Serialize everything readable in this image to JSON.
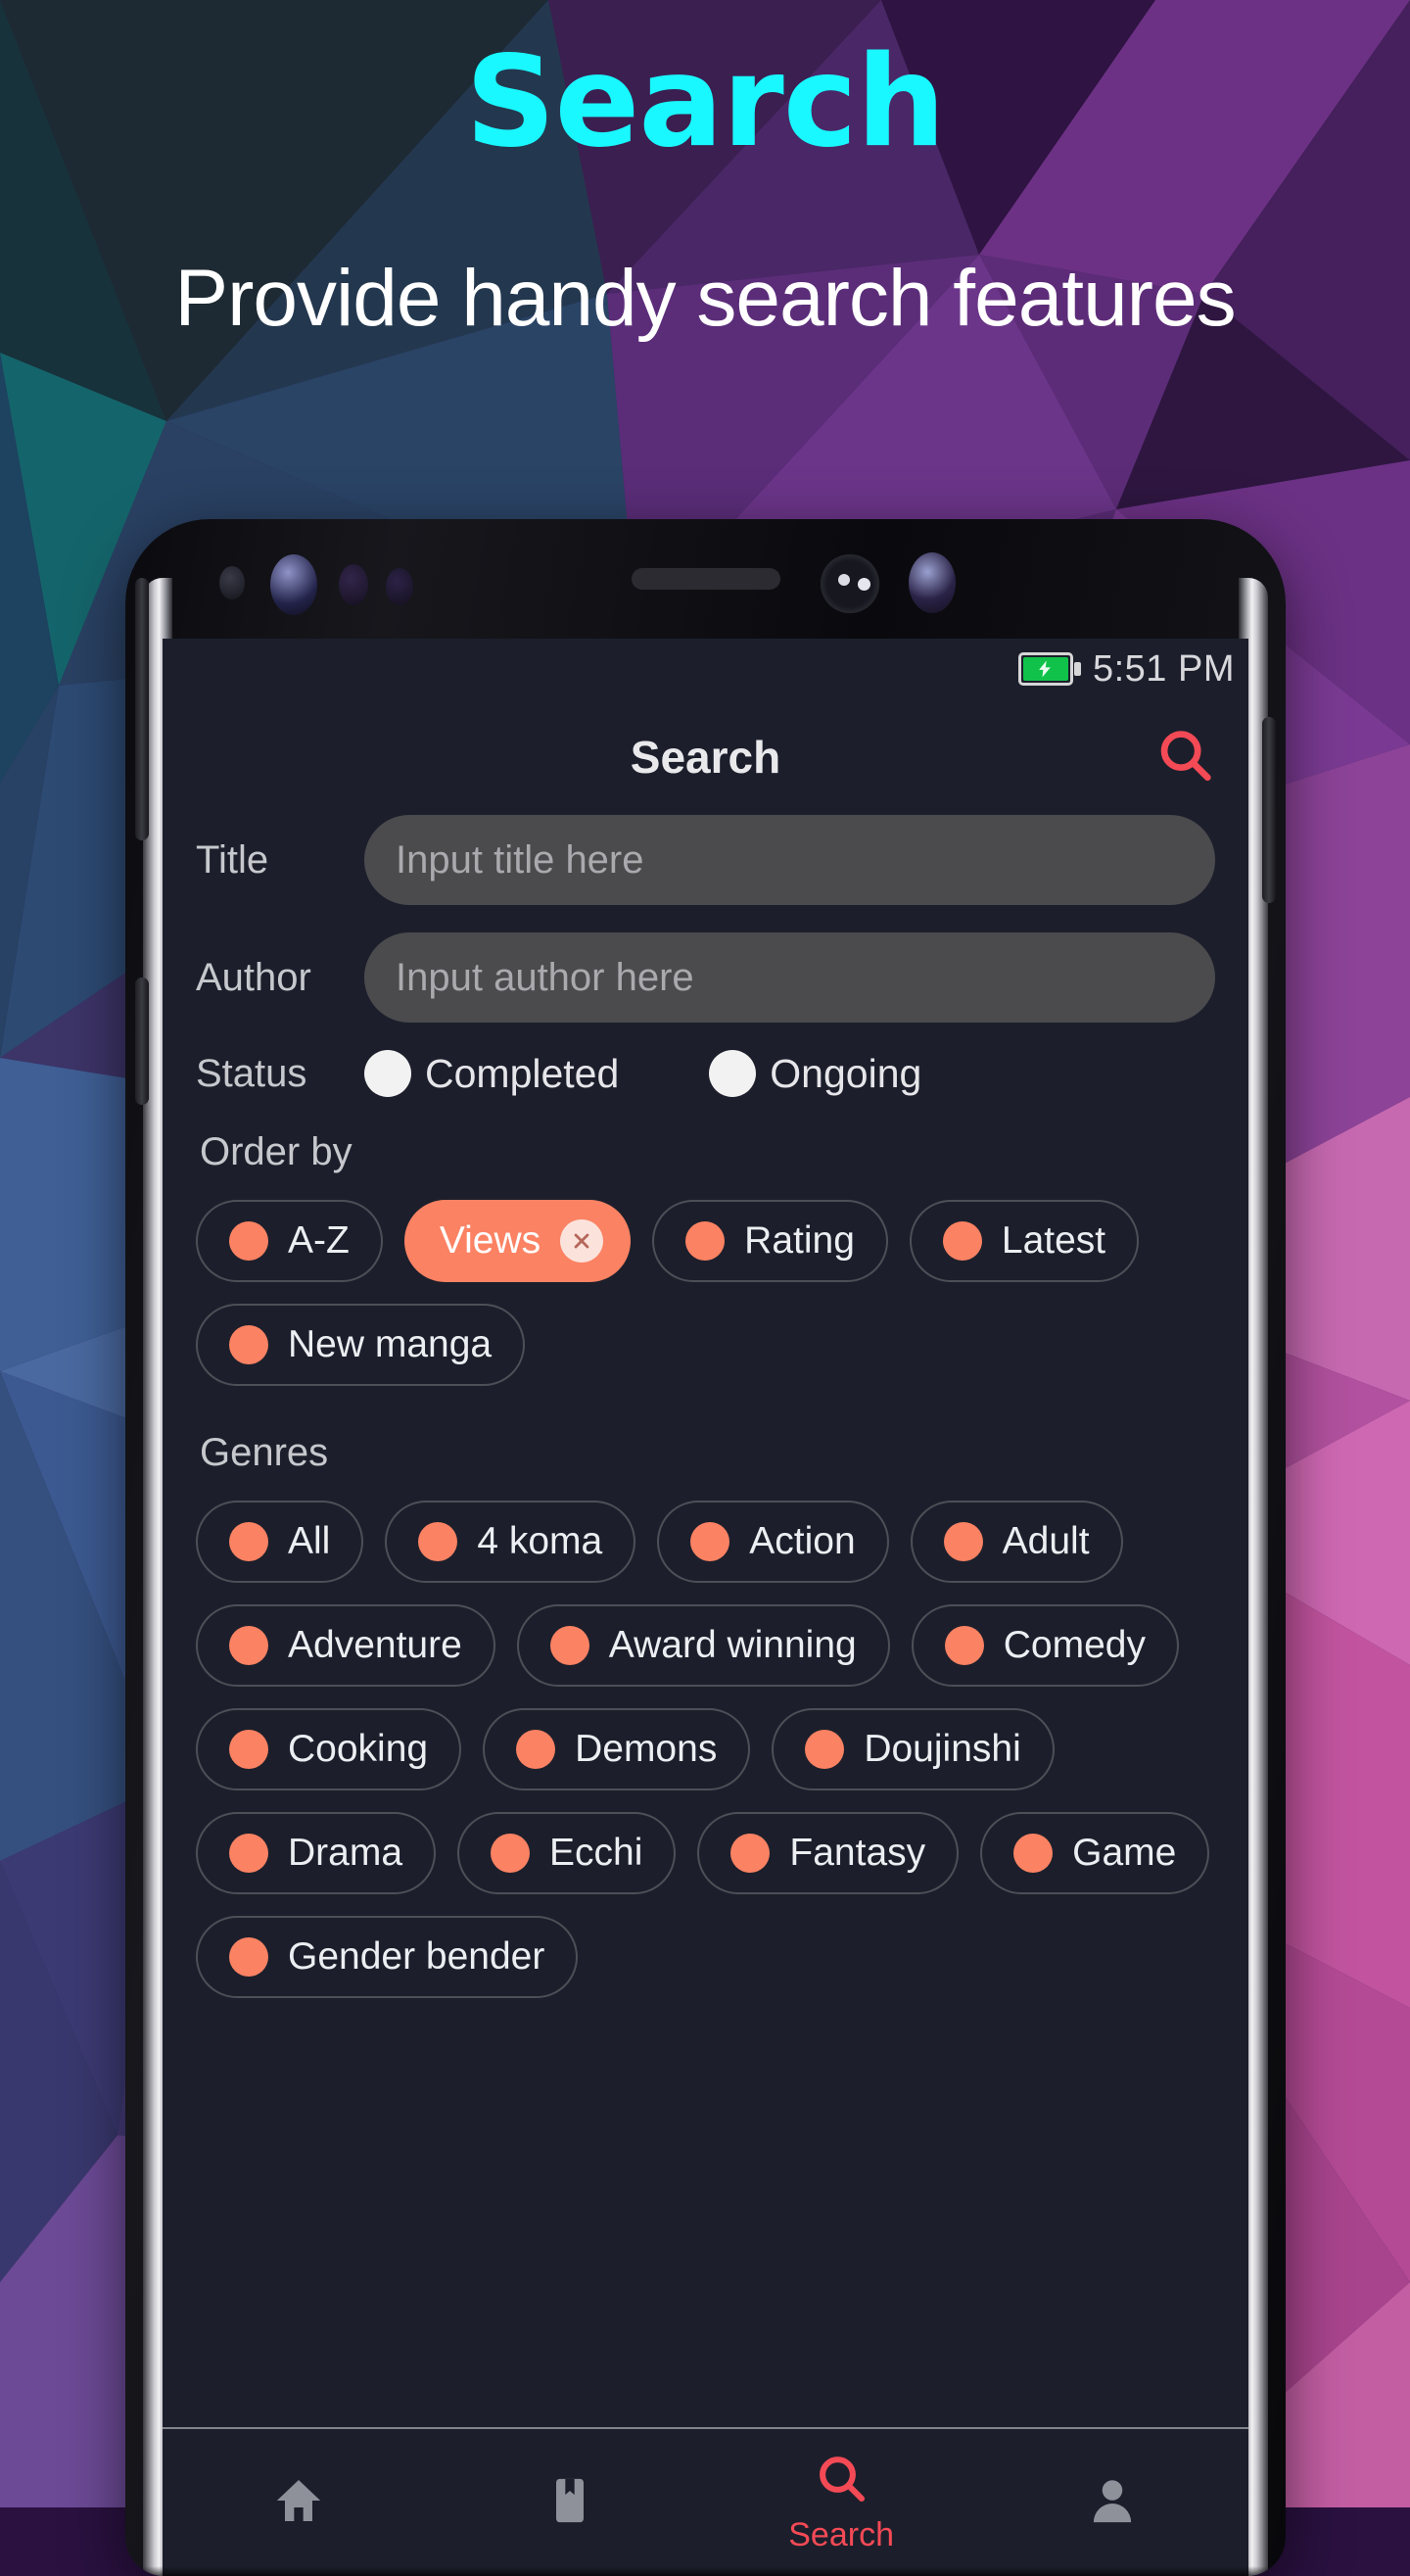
{
  "promo": {
    "title": "Search",
    "title_color": "#19f7ff",
    "subtitle": "Provide handy search features"
  },
  "device": {
    "status_bar": {
      "time": "5:51 PM",
      "battery_icon": "battery-charging-icon",
      "battery_color": "#10c24a"
    }
  },
  "app": {
    "accent_color": "#fb8263",
    "accent_red": "#f44a56",
    "appbar": {
      "title": "Search",
      "search_icon": "search-icon"
    },
    "fields": [
      {
        "label": "Title",
        "value": "",
        "placeholder": "Input title here"
      },
      {
        "label": "Author",
        "value": "",
        "placeholder": "Input author here"
      }
    ],
    "status": {
      "label": "Status",
      "options": [
        {
          "label": "Completed",
          "selected": false
        },
        {
          "label": "Ongoing",
          "selected": false
        }
      ]
    },
    "order_by": {
      "label": "Order by",
      "chips": [
        {
          "label": "A-Z",
          "selected": false
        },
        {
          "label": "Views",
          "selected": true
        },
        {
          "label": "Rating",
          "selected": false
        },
        {
          "label": "Latest",
          "selected": false
        },
        {
          "label": "New manga",
          "selected": false
        }
      ]
    },
    "genres": {
      "label": "Genres",
      "chips": [
        {
          "label": "All",
          "selected": false
        },
        {
          "label": "4 koma",
          "selected": false
        },
        {
          "label": "Action",
          "selected": false
        },
        {
          "label": "Adult",
          "selected": false
        },
        {
          "label": "Adventure",
          "selected": false
        },
        {
          "label": "Award winning",
          "selected": false
        },
        {
          "label": "Comedy",
          "selected": false
        },
        {
          "label": "Cooking",
          "selected": false
        },
        {
          "label": "Demons",
          "selected": false
        },
        {
          "label": "Doujinshi",
          "selected": false
        },
        {
          "label": "Drama",
          "selected": false
        },
        {
          "label": "Ecchi",
          "selected": false
        },
        {
          "label": "Fantasy",
          "selected": false
        },
        {
          "label": "Game",
          "selected": false
        },
        {
          "label": "Gender bender",
          "selected": false
        }
      ]
    },
    "bottom_nav": [
      {
        "label": "",
        "icon": "home-icon",
        "active": false
      },
      {
        "label": "",
        "icon": "bookmark-icon",
        "active": false
      },
      {
        "label": "Search",
        "icon": "search-icon",
        "active": true
      },
      {
        "label": "",
        "icon": "person-icon",
        "active": false
      }
    ]
  }
}
